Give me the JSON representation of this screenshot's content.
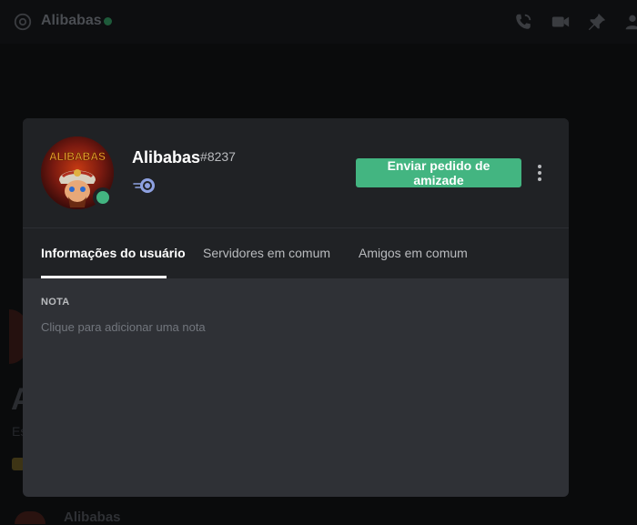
{
  "background": {
    "channel_name": "Alibabas",
    "big_letter": "A",
    "small_text": "Es",
    "bottom_name": "Alibabas"
  },
  "profile": {
    "username": "Alibabas",
    "discriminator": "#8237",
    "avatar_text": "ALIBABAS",
    "status": "online",
    "badge": "hypesquad-balance-icon",
    "friend_button_label": "Enviar pedido de amizade"
  },
  "tabs": [
    {
      "label": "Informações do usuário",
      "active": true
    },
    {
      "label": "Servidores em comum",
      "active": false
    },
    {
      "label": "Amigos em comum",
      "active": false
    }
  ],
  "note": {
    "label": "NOTA",
    "placeholder": "Clique para adicionar uma nota"
  },
  "colors": {
    "accent_green": "#43b581",
    "modal_bg": "#2f3136",
    "header_bg": "#202225"
  }
}
